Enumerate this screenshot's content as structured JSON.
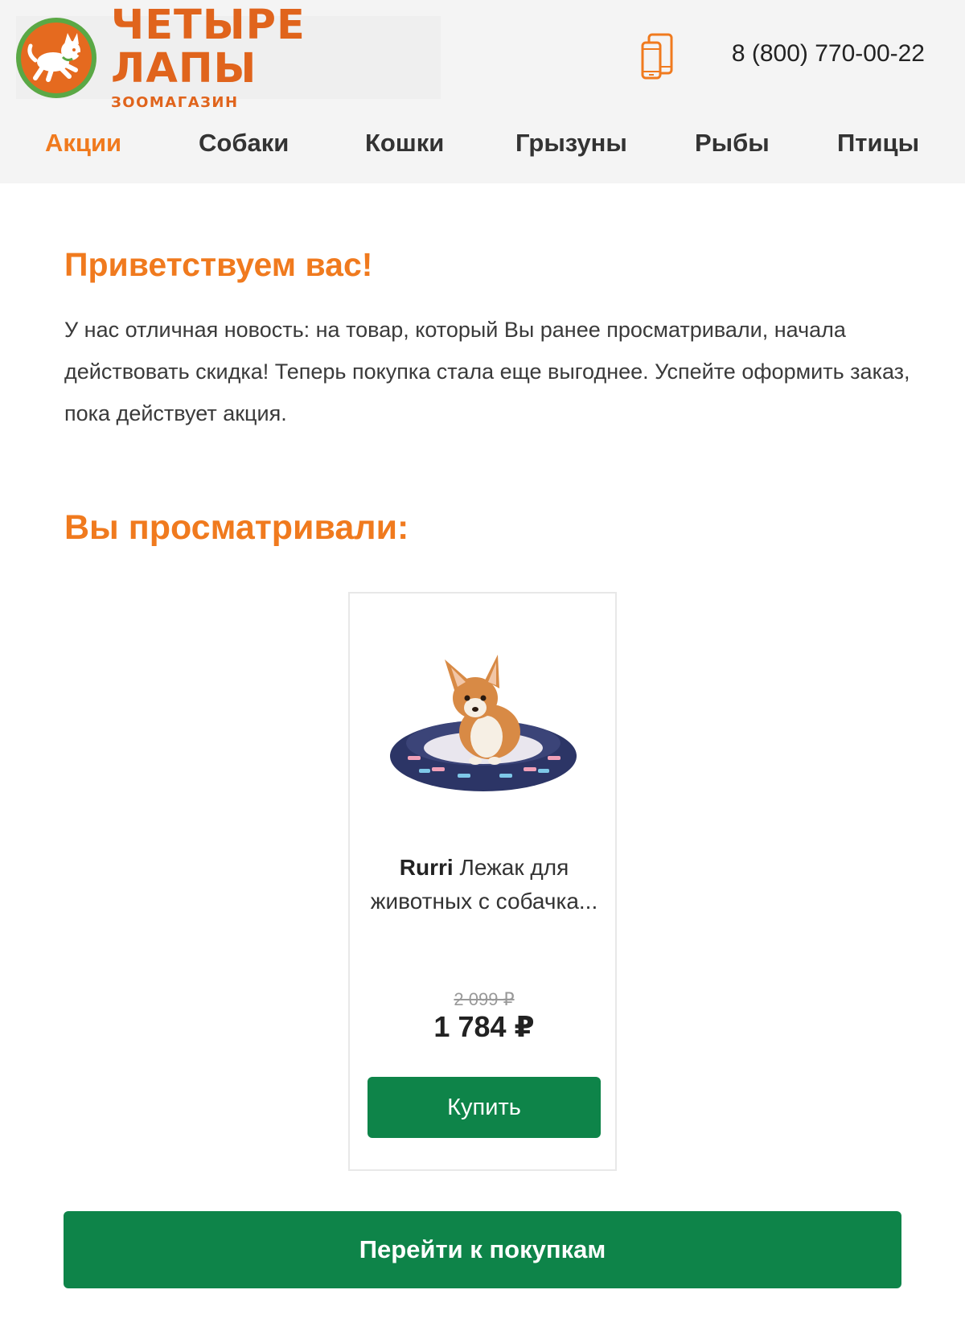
{
  "header": {
    "brand_name": "ЧЕТЫРЕ ЛАПЫ",
    "brand_subtitle": "ЗООМАГАЗИН",
    "phone": "8 (800) 770-00-22",
    "accent_color": "#e0641c",
    "logo_ring_color": "#5aa845"
  },
  "nav": {
    "items": [
      {
        "label": "Акции",
        "active": true
      },
      {
        "label": "Собаки"
      },
      {
        "label": "Кошки"
      },
      {
        "label": "Грызуны"
      },
      {
        "label": "Рыбы"
      },
      {
        "label": "Птицы"
      }
    ]
  },
  "greeting": {
    "title": "Приветствуем вас!",
    "body": "У нас отличная новость: на товар, который Вы ранее просматривали, начала действовать скидка! Теперь покупка стала еще выгоднее. Успейте оформить заказ, пока действует акция."
  },
  "viewed": {
    "title": "Вы просматривали:",
    "product": {
      "brand": "Rurri",
      "name": "Лежак для животных с собачка...",
      "old_price": "2 099 ₽",
      "price": "1 784 ₽",
      "buy_label": "Купить",
      "image_icon": "corgi-on-pet-bed-image"
    }
  },
  "cta": {
    "label": "Перейти к покупкам",
    "color": "#0e8449"
  }
}
